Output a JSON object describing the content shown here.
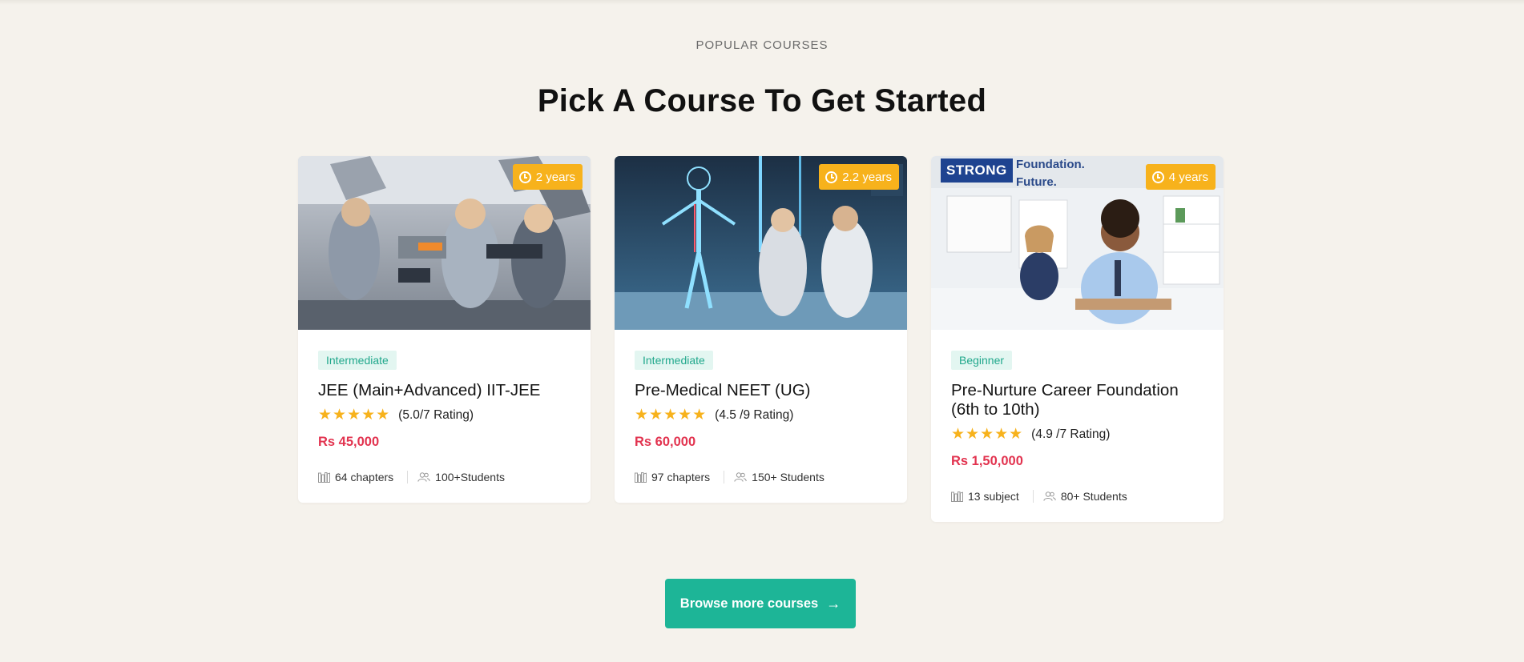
{
  "section": {
    "eyebrow": "POPULAR COURSES",
    "heading": "Pick A Course To Get Started"
  },
  "courses": [
    {
      "image_alt": "Students working on a satellite model",
      "duration": "2 years",
      "level": "Intermediate",
      "title": "JEE (Main+Advanced) IIT-JEE",
      "stars": "★★★★★",
      "rating": "(5.0/7 Rating)",
      "price": "Rs 45,000",
      "units": "64 chapters",
      "students": "100+Students"
    },
    {
      "image_alt": "Doctors with a holographic human body",
      "duration": "2.2 years",
      "level": "Intermediate",
      "title": "Pre-Medical NEET (UG)",
      "stars": "★★★★★",
      "rating": "(4.5 /9 Rating)",
      "price": "Rs 60,000",
      "units": "97 chapters",
      "students": "150+ Students"
    },
    {
      "image_alt": "Children in a classroom",
      "image_text_strong": "STRONG",
      "image_text_line1": "Foundation.",
      "image_text_line2": "Future.",
      "duration": "4 years",
      "level": "Beginner",
      "title": "Pre-Nurture Career Foundation (6th to 10th)",
      "stars": "★★★★★",
      "rating": "(4.9 /7 Rating)",
      "price": "Rs 1,50,000",
      "units": "13 subject",
      "students": "80+ Students"
    }
  ],
  "browse_button": {
    "label": "Browse more courses",
    "icon": "arrow-right-icon"
  },
  "colors": {
    "background": "#f5f2ec",
    "accent": "#1db597",
    "badge": "#f7b21c",
    "price": "#e2334f",
    "level_text": "#21a88c",
    "level_bg": "#e3f6f1"
  }
}
